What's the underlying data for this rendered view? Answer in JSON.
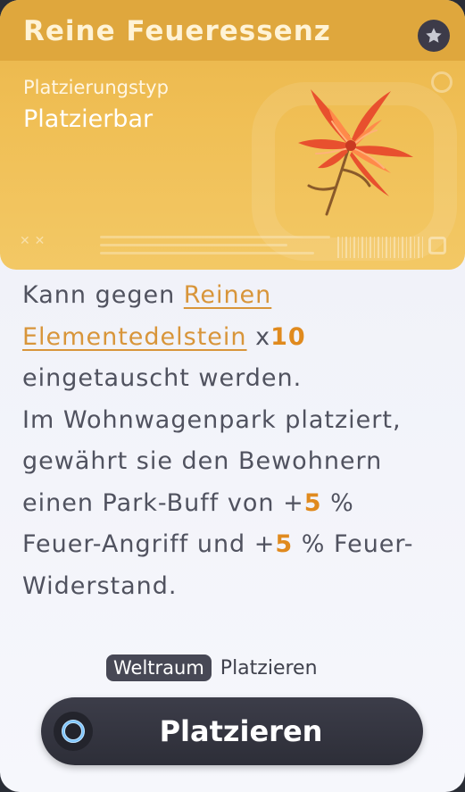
{
  "item": {
    "title": "Reine Feueressenz",
    "type_label": "Platzierungstyp",
    "type_value": "Platzierbar",
    "icon": "fire-flower-icon"
  },
  "description": {
    "line1_a": "Kann gegen ",
    "link_part1": "Reinen",
    "link_part2": "Elementedelstein",
    "qty_prefix": " x",
    "qty_value": "10",
    "line3": "eingetauscht werden.",
    "line4": "Im Wohnwagenpark platziert,",
    "line5": "gewährt sie den Bewohnern",
    "line6_a": "einen Park-Buff von +",
    "buff1_value": "5",
    "line6_b": " %",
    "line7_a": "Feuer-Angriff und +",
    "buff2_value": "5",
    "line7_b": " % Feuer-",
    "line8": "Widerstand."
  },
  "hint": {
    "key": "Weltraum",
    "action": "Platzieren"
  },
  "button": {
    "label": "Platzieren",
    "icon": "circle-ring-icon"
  },
  "colors": {
    "header": "#f0bf55",
    "accent": "#e08a1e",
    "button": "#2d2e38"
  }
}
